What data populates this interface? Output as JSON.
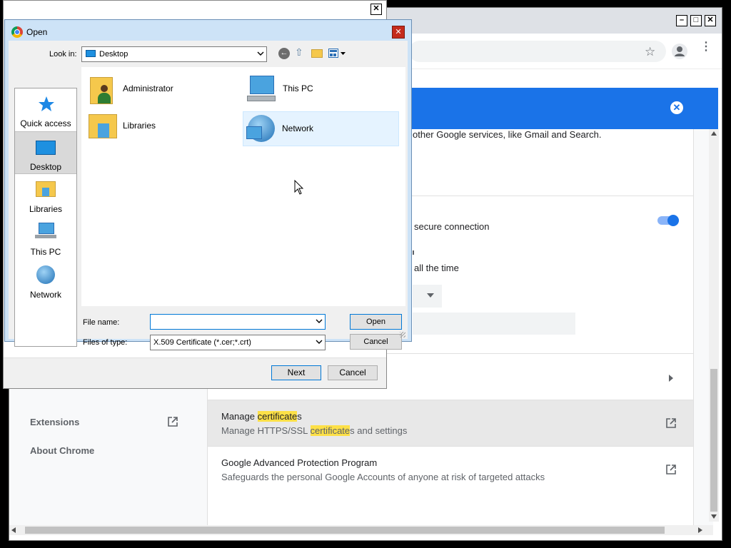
{
  "chrome": {
    "sections": {
      "sync_text": "other Google services, like Gmail and Search.",
      "secure_connection_text": "secure connection",
      "all_the_time_text": "all the time"
    },
    "manage_certificates": {
      "title_before": "Manage ",
      "title_highlight": "certificate",
      "title_after": "s",
      "sub_before": "Manage HTTPS/SSL ",
      "sub_highlight": "certificate",
      "sub_after": "s and settings"
    },
    "advanced_protection": {
      "title": "Google Advanced Protection Program",
      "subtitle": "Safeguards the personal Google Accounts of anyone at risk of targeted attacks"
    },
    "sidebar": {
      "extensions": "Extensions",
      "about": "About Chrome"
    },
    "colors": {
      "accent": "#1a73e8",
      "highlight": "#fde047"
    }
  },
  "wizard": {
    "next_label": "Next",
    "cancel_label": "Cancel",
    "close_glyph": "✕"
  },
  "open_dialog": {
    "title": "Open",
    "look_in_label": "Look in:",
    "look_in_value": "Desktop",
    "places": [
      {
        "label": "Quick access",
        "icon": "star-icon"
      },
      {
        "label": "Desktop",
        "icon": "desktop-icon"
      },
      {
        "label": "Libraries",
        "icon": "libraries-icon"
      },
      {
        "label": "This PC",
        "icon": "computer-icon"
      },
      {
        "label": "Network",
        "icon": "network-icon"
      }
    ],
    "files": [
      {
        "label": "Administrator",
        "icon": "user-folder-icon"
      },
      {
        "label": "This PC",
        "icon": "computer-icon"
      },
      {
        "label": "Libraries",
        "icon": "libraries-icon"
      },
      {
        "label": "Network",
        "icon": "network-icon"
      }
    ],
    "file_name_label": "File name:",
    "file_name_value": "",
    "file_type_label": "Files of type:",
    "file_type_value": "X.509 Certificate (*.cer;*.crt)",
    "open_button": "Open",
    "cancel_button": "Cancel",
    "close_glyph": "✕"
  }
}
